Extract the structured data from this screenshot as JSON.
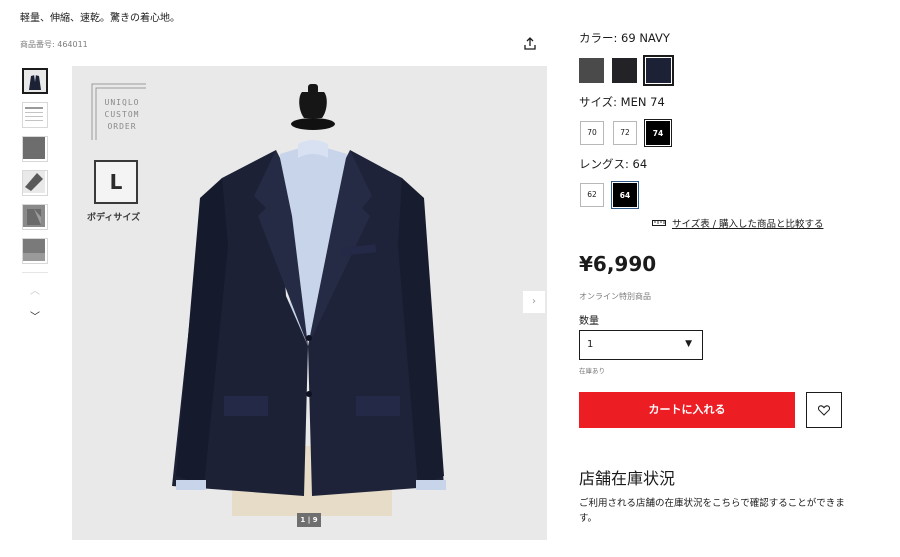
{
  "header": {
    "tagline": "軽量、伸縮、速乾。驚きの着心地。",
    "product_code": "商品番号: 464011"
  },
  "gallery": {
    "thumbnails": [
      {
        "name": "jacket-front"
      },
      {
        "name": "size-chart"
      },
      {
        "name": "fabric-gray"
      },
      {
        "name": "sleeve-detail"
      },
      {
        "name": "lining-detail"
      },
      {
        "name": "fabric-closeup"
      }
    ],
    "counter": "1 | 9",
    "overlay": {
      "brand_lines": [
        "UNIQLO",
        "CUSTOM",
        "ORDER"
      ],
      "size_letter": "L",
      "size_caption": "ボディサイズ"
    }
  },
  "options": {
    "color": {
      "label": "カラー: 69 NAVY",
      "swatches": [
        {
          "name": "dark-gray",
          "color": "#4a4a4a"
        },
        {
          "name": "black",
          "color": "#232327"
        },
        {
          "name": "navy",
          "color": "#1c2136",
          "selected": true
        }
      ]
    },
    "size": {
      "label": "サイズ: MEN 74",
      "chips": [
        "70",
        "72",
        "74"
      ],
      "selected": "74"
    },
    "length": {
      "label": "レングス: 64",
      "chips": [
        "62",
        "64"
      ],
      "selected": "64"
    },
    "size_link": "サイズ表 / 購入した商品と比較する"
  },
  "purchase": {
    "price": "¥6,990",
    "online_only": "オンライン特別商品",
    "quantity_label": "数量",
    "quantity_value": "1",
    "stock_status": "在庫あり",
    "cart_button": "カートに入れる"
  },
  "store": {
    "title": "店舗在庫状況",
    "description": "ご利用される店舗の在庫状況をこちらで確認することができます。"
  },
  "colors": {
    "accent_red": "#ed1d24",
    "jacket_navy": "#1c2136",
    "image_bg": "#e9e9e9"
  }
}
